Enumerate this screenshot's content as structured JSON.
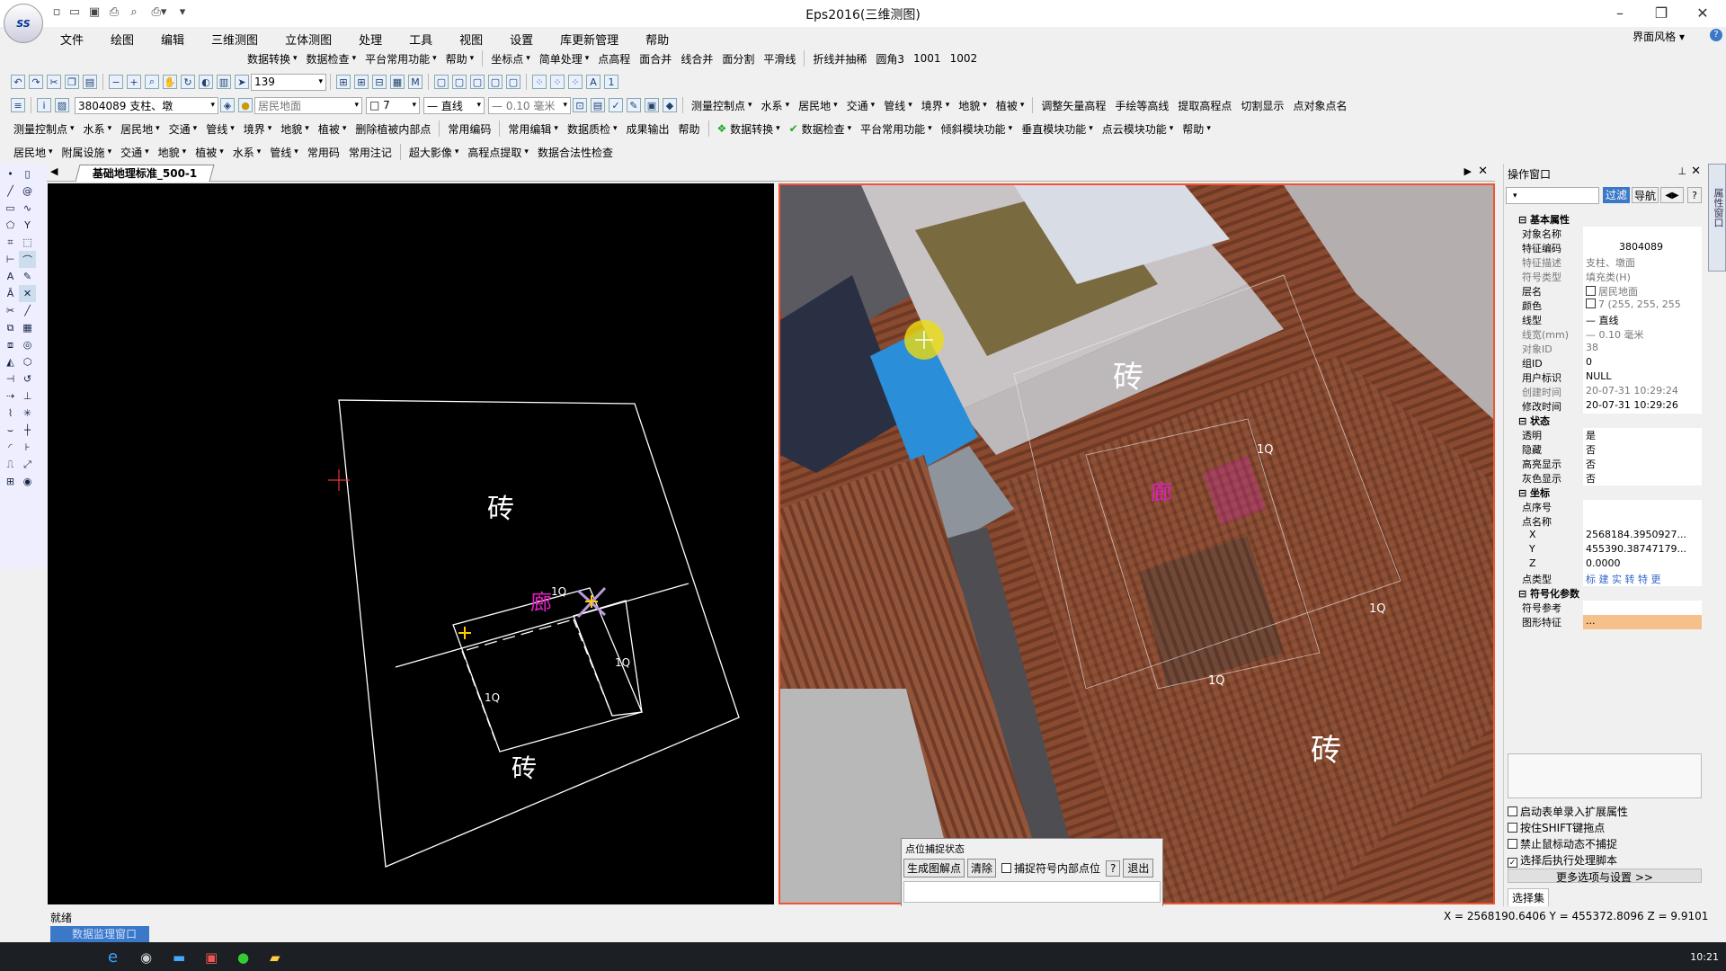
{
  "titlebar": {
    "title": "Eps2016(三维测图)",
    "quick_icons": [
      "new-icon",
      "open-icon",
      "save-icon",
      "print-icon",
      "print-preview-icon",
      "printer-dropdown-icon",
      "customize-icon"
    ],
    "minimize": "–",
    "maximize": "❐",
    "close": "✕"
  },
  "menubar": {
    "items": [
      "文件",
      "绘图",
      "编辑",
      "三维测图",
      "立体测图",
      "处理",
      "工具",
      "视图",
      "设置",
      "库更新管理",
      "帮助"
    ],
    "skin": "界面风格 ▾"
  },
  "toolbar1": {
    "items": [
      "数据转换",
      "数据检查",
      "平台常用功能",
      "帮助",
      "坐标点",
      "简单处理",
      "点高程",
      "面合并",
      "线合并",
      "面分割",
      "平滑线",
      "折线并抽稀",
      "圆角3",
      "1001",
      "1002"
    ]
  },
  "toolbar2": {
    "zoom_value": "139"
  },
  "toolbar3": {
    "feature_code": "3804089 支柱、墩",
    "layer": "居民地面",
    "color_index": "7",
    "linetype": "直线",
    "linewidth": "0.10 毫米",
    "items": [
      "测量控制点",
      "水系",
      "居民地",
      "交通",
      "管线",
      "境界",
      "地貌",
      "植被",
      "调整矢量高程",
      "手绘等高线",
      "提取高程点",
      "切割显示",
      "点对象点名"
    ]
  },
  "toolbar4": {
    "items": [
      "测量控制点",
      "水系",
      "居民地",
      "交通",
      "管线",
      "境界",
      "地貌",
      "植被",
      "删除植被内部点",
      "常用编码",
      "常用编辑",
      "数据质检",
      "成果输出",
      "帮助",
      "数据转换",
      "数据检查",
      "平台常用功能",
      "倾斜模块功能",
      "垂直模块功能",
      "点云模块功能",
      "帮助"
    ]
  },
  "toolbar5": {
    "items": [
      "居民地",
      "附属设施",
      "交通",
      "地貌",
      "植被",
      "水系",
      "管线",
      "常用码",
      "常用注记",
      "超大影像",
      "高程点提取",
      "数据合法性检查"
    ]
  },
  "doc_tab": {
    "label": "基础地理标准_500-1"
  },
  "cad": {
    "label_brick_top": "砖",
    "label_brick_bottom": "砖",
    "label_corridor": "廊",
    "label_1q_a": "1Q",
    "label_1q_b": "1Q",
    "label_1q_c": "1Q"
  },
  "photo": {
    "label_brick_1": "砖",
    "label_brick_2": "砖",
    "label_1q_a": "1Q",
    "label_1q_b": "1Q",
    "label_1q_c": "1Q",
    "label_corridor": "廊"
  },
  "snap_dialog": {
    "title": "点位捕捉状态",
    "generate": "生成图解点",
    "clear": "清除",
    "capture_inner": "捕捉符号内部点位",
    "help": "?",
    "exit": "退出"
  },
  "panel": {
    "title": "操作窗口",
    "filter": "过滤",
    "nav": "导航",
    "help": "?",
    "sections": {
      "basic": "基本属性",
      "state": "状态",
      "coord": "坐标",
      "symbol": "符号化参数"
    },
    "rows": {
      "obj_name": {
        "k": "对象名称",
        "v": ""
      },
      "code": {
        "k": "特征编码",
        "v": "3804089"
      },
      "desc": {
        "k": "特征描述",
        "v": "支柱、墩面"
      },
      "symtype": {
        "k": "符号类型",
        "v": "填充类(H)"
      },
      "layer": {
        "k": "层名",
        "v": "居民地面"
      },
      "color": {
        "k": "颜色",
        "v": "7 (255, 255, 255"
      },
      "linetype": {
        "k": "线型",
        "v": "直线"
      },
      "linewidth": {
        "k": "线宽(mm)",
        "v": "0.10 毫米"
      },
      "objid": {
        "k": "对象ID",
        "v": "38"
      },
      "groupid": {
        "k": "组ID",
        "v": "0"
      },
      "userflag": {
        "k": "用户标识",
        "v": "NULL"
      },
      "ctime": {
        "k": "创建时间",
        "v": "20-07-31 10:29:24"
      },
      "mtime": {
        "k": "修改时间",
        "v": "20-07-31 10:29:26"
      },
      "transparent": {
        "k": "透明",
        "v": "是"
      },
      "hidden": {
        "k": "隐藏",
        "v": "否"
      },
      "elev": {
        "k": "高亮显示",
        "v": "否"
      },
      "gray": {
        "k": "灰色显示",
        "v": "否"
      },
      "pointno": {
        "k": "点序号",
        "v": ""
      },
      "pointname": {
        "k": "点名称",
        "v": ""
      },
      "x": {
        "k": "X",
        "v": "2568184.3950927..."
      },
      "y": {
        "k": "Y",
        "v": "455390.38747179..."
      },
      "z": {
        "k": "Z",
        "v": "0.0000"
      },
      "ptype": {
        "k": "点类型",
        "v": "标 建 实 转 特 更"
      },
      "symref": {
        "k": "符号参考",
        "v": ""
      },
      "shape": {
        "k": "图形特征",
        "v": "..."
      }
    },
    "options": [
      "启动表单录入扩展属性",
      "按住SHIFT键拖点",
      "禁止鼠标动态不捕捉",
      "选择后执行处理脚本"
    ],
    "options_checked": [
      false,
      false,
      false,
      true
    ],
    "more": "更多选项与设置 >>",
    "selection_tab": "选择集",
    "side_tab": "属性窗口"
  },
  "status": {
    "ready": "就绪",
    "coords": "X = 2568190.6406 Y = 455372.8096 Z = 9.9101",
    "monitor_tab": "数据监理窗口"
  },
  "taskbar": {
    "apps": [
      "edge-icon",
      "app-icon",
      "explorer-icon",
      "photo-icon",
      "wechat-icon",
      "folder-icon"
    ],
    "time": "10:21"
  },
  "colors": {
    "accent": "#3c78c8",
    "border_red": "#e53322",
    "magenta": "#e020c0"
  }
}
